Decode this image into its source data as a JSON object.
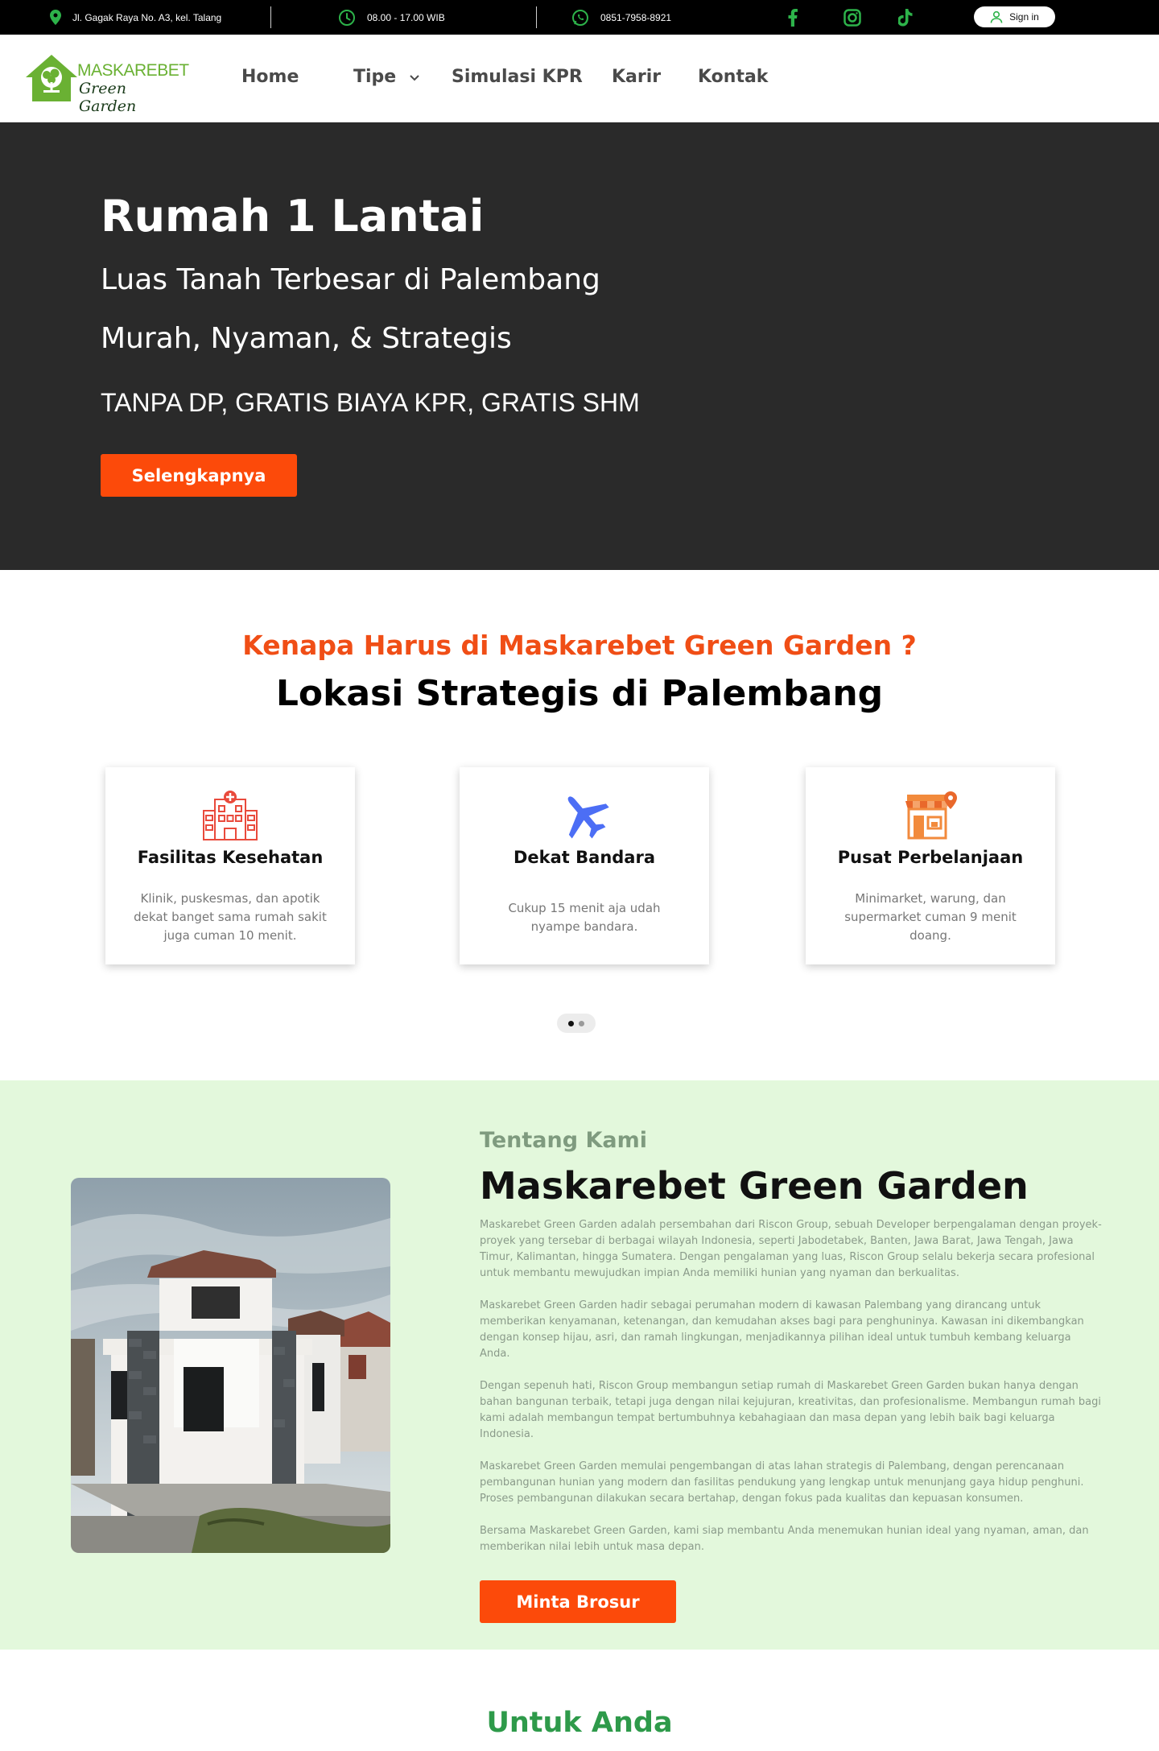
{
  "topbar": {
    "address": "Jl. Gagak Raya No. A3, kel. Talang",
    "hours": "08.00 - 17.00 WIB",
    "phone": "0851-7958-8921",
    "signin_label": "Sign in",
    "social": [
      "facebook-icon",
      "instagram-icon",
      "tiktok-icon"
    ],
    "icon_color": "#2db34a"
  },
  "logo": {
    "top": "MASKAREBET",
    "bottom": "Green Garden"
  },
  "nav": {
    "home": "Home",
    "tipe": "Tipe",
    "simulasi": "Simulasi KPR",
    "karir": "Karir",
    "kontak": "Kontak"
  },
  "hero": {
    "title": "Rumah 1 Lantai",
    "line1": "Luas Tanah Terbesar di Palembang",
    "line2": "Murah, Nyaman, & Strategis",
    "line3": "TANPA DP, GRATIS BIAYA KPR, GRATIS SHM",
    "button": "Selengkapnya",
    "bg": "#2a2a2a"
  },
  "why": {
    "subtitle": "Kenapa Harus di Maskarebet Green Garden ?",
    "title": "Lokasi Strategis di Palembang",
    "cards": [
      {
        "title": "Fasilitas Kesehatan",
        "desc": "Klinik, puskesmas, dan apotik dekat banget sama rumah sakit juga cuman 10 menit.",
        "icon": "hospital-icon"
      },
      {
        "title": "Dekat Bandara",
        "desc": "Cukup 15 menit aja udah nyampe bandara.",
        "icon": "airplane-icon"
      },
      {
        "title": "Pusat Perbelanjaan",
        "desc": "Minimarket, warung, dan supermarket cuman 9 menit doang.",
        "icon": "store-icon"
      }
    ],
    "carousel_active_index": 0,
    "carousel_count": 2
  },
  "about": {
    "kicker": "Tentang Kami",
    "title": "Maskarebet Green Garden",
    "paragraphs": [
      "Maskarebet Green Garden adalah persembahan dari Riscon Group, sebuah Developer berpengalaman dengan proyek-proyek yang tersebar di berbagai wilayah Indonesia, seperti Jabodetabek, Banten, Jawa Barat, Jawa Tengah, Jawa Timur, Kalimantan, hingga Sumatera. Dengan pengalaman yang luas, Riscon Group selalu bekerja secara profesional untuk membantu mewujudkan impian Anda memiliki hunian yang nyaman dan berkualitas.",
      "Maskarebet Green Garden hadir sebagai perumahan modern di kawasan Palembang yang dirancang untuk memberikan kenyamanan, ketenangan, dan kemudahan akses bagi para penghuninya. Kawasan ini dikembangkan dengan konsep hijau, asri, dan ramah lingkungan, menjadikannya pilihan ideal untuk tumbuh kembang keluarga Anda.",
      "Dengan sepenuh hati, Riscon Group membangun setiap rumah di Maskarebet Green Garden bukan hanya dengan bahan bangunan terbaik, tetapi juga dengan nilai kejujuran, kreativitas, dan profesionalisme. Membangun rumah bagi kami adalah membangun tempat bertumbuhnya kebahagiaan dan masa depan yang lebih baik bagi keluarga Indonesia.",
      "Maskarebet Green Garden memulai pengembangan di atas lahan strategis di Palembang, dengan perencanaan pembangunan hunian yang modern dan fasilitas pendukung yang lengkap untuk menunjang gaya hidup penghuni. Proses pembangunan dilakukan secara bertahap, dengan fokus pada kualitas dan kepuasan konsumen.",
      "Bersama Maskarebet Green Garden, kami siap membantu Anda menemukan hunian ideal yang nyaman, aman, dan memberikan nilai lebih untuk masa depan."
    ],
    "button": "Minta Brosur",
    "bg": "#e3f8dc"
  },
  "for_you": {
    "title": "Untuk Anda"
  },
  "colors": {
    "accent": "#fc4a0a",
    "brand_green": "#6ab133"
  }
}
